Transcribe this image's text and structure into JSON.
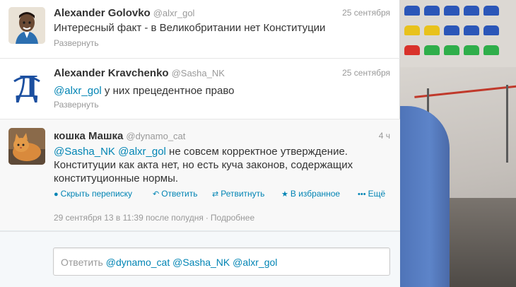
{
  "tweets": [
    {
      "fullname": "Alexander Golovko",
      "username": "@alxr_gol",
      "time": "25 сентября",
      "text": "Интересный факт - в Великобритании нет Конституции",
      "expand": "Развернуть"
    },
    {
      "fullname": "Alexander Kravchenko",
      "username": "@Sasha_NK",
      "time": "25 сентября",
      "mention": "@alxr_gol",
      "text_rest": " у них прецедентное право",
      "expand": "Развернуть"
    },
    {
      "fullname": "кошка Машка",
      "username": "@dynamo_cat",
      "time": "4 ч",
      "mention1": "@Sasha_NK",
      "mention2": "@alxr_gol",
      "text_rest": " не совсем корректное утверждение. Конституции как акта нет, но есть куча законов, содержащих конституционные нормы.",
      "actions": {
        "hide": "Скрыть переписку",
        "reply": "Ответить",
        "retweet": "Ретвитнуть",
        "favorite": "В избранное",
        "more": "Ещё"
      },
      "timestamp": "29 сентября 13 в 11:39 после полудня",
      "details": "Подробнее"
    }
  ],
  "reply_box": {
    "prefix": "Ответить ",
    "mention1": "@dynamo_cat",
    "mention2": "@Sasha_NK",
    "mention3": "@alxr_gol"
  },
  "colors": {
    "link": "#0084b4",
    "muted": "#999999",
    "text": "#333333"
  },
  "icons": {
    "hide": "chat-bubble-icon",
    "reply": "reply-arrow-icon",
    "retweet": "retweet-icon",
    "favorite": "star-icon",
    "more": "ellipsis-icon"
  }
}
